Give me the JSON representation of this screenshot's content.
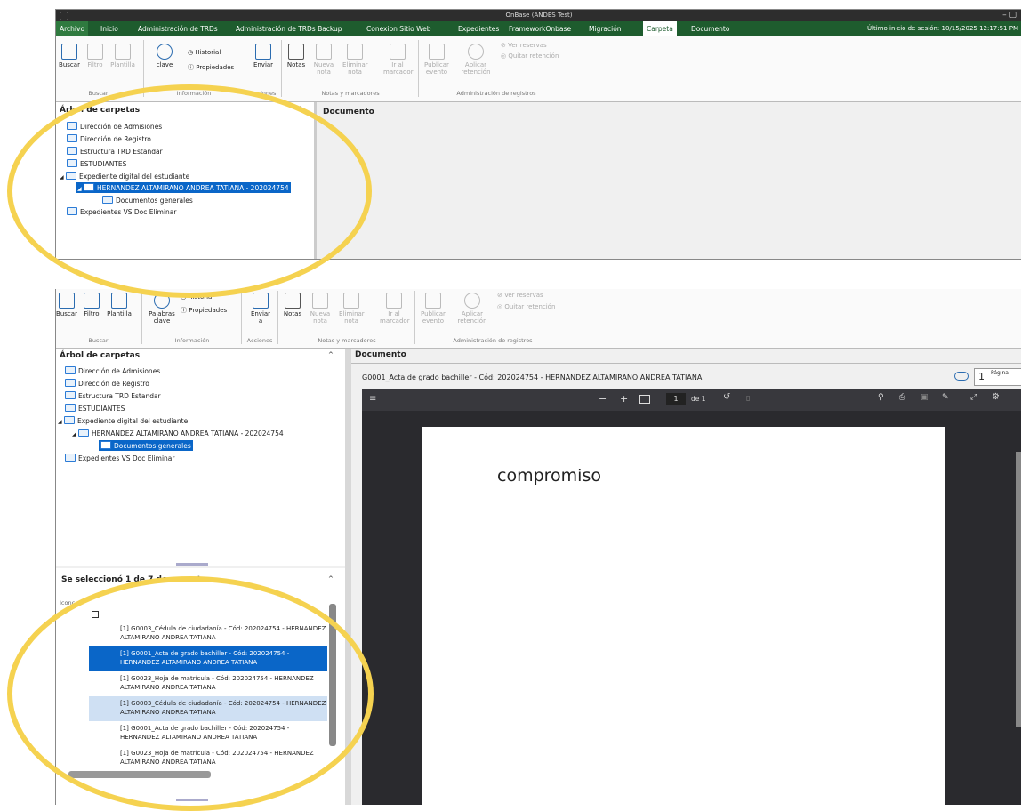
{
  "window_title": "OnBase (ANDES Test)",
  "session": "Último inicio de sesión: 10/15/2025 12:17:51 PM",
  "menu": [
    "Archivo",
    "Inicio",
    "Administración de TRDs",
    "Administración de TRDs Backup",
    "Conexion Sitio Web",
    "Expedientes",
    "FrameworkOnbase",
    "Migración",
    "Carpeta",
    "Documento"
  ],
  "ribbon": {
    "buscar": "Buscar",
    "filtro": "Filtro",
    "plantilla": "Plantilla",
    "palabras_clave": "Palabras clave",
    "clave": "clave",
    "historial": "Historial",
    "propiedades": "Propiedades",
    "enviar": "Enviar",
    "enviar_a": "Enviar a",
    "notas": "Notas",
    "nueva_nota": "Nueva nota",
    "eliminar_nota": "Eliminar nota",
    "ir_marcador": "Ir al marcador",
    "publicar_evento": "Publicar evento",
    "aplicar_retencion": "Aplicar retención",
    "ver_reservas": "Ver reservas",
    "quitar_retencion": "Quitar retención",
    "groups": {
      "buscar": "Buscar",
      "informacion": "Información",
      "acciones": "Acciones",
      "notas": "Notas y marcadores",
      "admin": "Administración de registros"
    }
  },
  "folder_panel": {
    "title": "Árbol de carpetas",
    "items": [
      "Dirección de Admisiones",
      "Dirección de Registro",
      "Estructura TRD Estandar",
      "ESTUDIANTES",
      "Expediente digital del estudiante",
      "HERNANDEZ ALTAMIRANO ANDREA TATIANA - 202024754",
      "Documentos generales",
      "Expedientes VS Doc Eliminar"
    ]
  },
  "document_header": "Documento",
  "document_title": "G0001_Acta de grado bachiller - Cód: 202024754 - HERNANDEZ ALTAMIRANO ANDREA TATIANA",
  "page_count": "1",
  "page_label": "Página",
  "pdf": {
    "page": "1",
    "of": "de 1",
    "content": "compromiso"
  },
  "doc_list": {
    "title": "Se seleccionó 1 de 7 documentos",
    "col_icon": "Iconc",
    "items": [
      "[1] G0003_Cédula de ciudadanía - Cód: 202024754 - HERNANDEZ ALTAMIRANO ANDREA TATIANA",
      "[1] G0001_Acta de grado bachiller - Cód: 202024754 - HERNANDEZ ALTAMIRANO ANDREA TATIANA",
      "[1] G0023_Hoja de matrícula - Cód: 202024754 - HERNANDEZ ALTAMIRANO ANDREA TATIANA",
      "[1] G0003_Cédula de ciudadanía - Cód: 202024754 - HERNANDEZ ALTAMIRANO ANDREA TATIANA",
      "[1] G0001_Acta de grado bachiller - Cód: 202024754 - HERNANDEZ ALTAMIRANO ANDREA TATIANA",
      "[1] G0023_Hoja de matrícula - Cód: 202024754 - HERNANDEZ ALTAMIRANO ANDREA TATIANA"
    ]
  }
}
